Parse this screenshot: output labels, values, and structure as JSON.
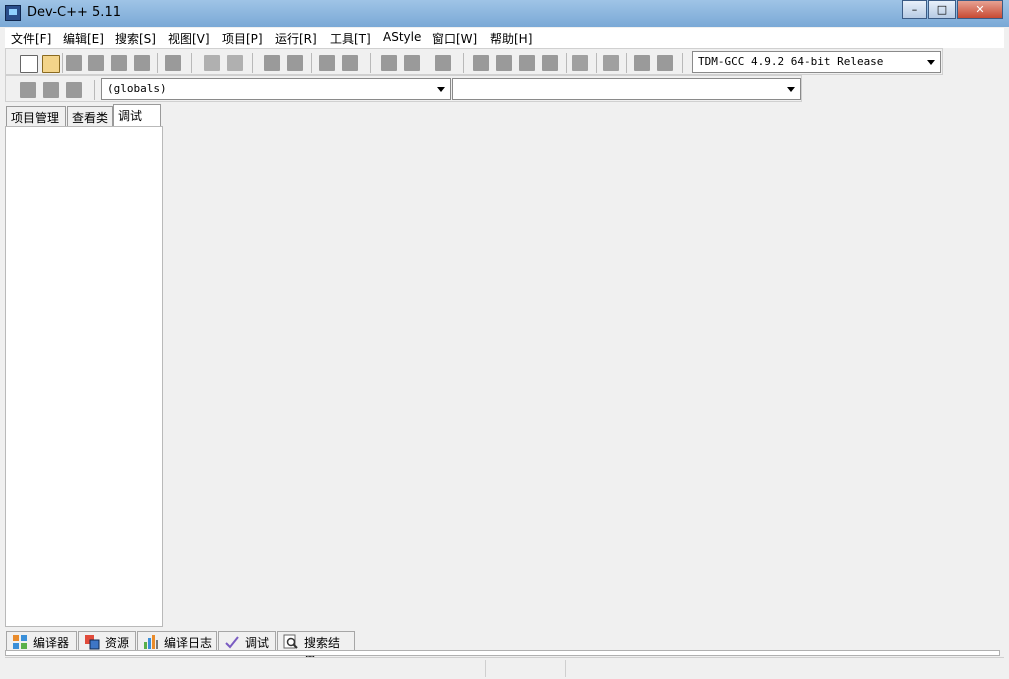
{
  "window": {
    "title": "Dev-C++ 5.11"
  },
  "menus": [
    {
      "label": "文件[F]"
    },
    {
      "label": "编辑[E]"
    },
    {
      "label": "搜索[S]"
    },
    {
      "label": "视图[V]"
    },
    {
      "label": "项目[P]"
    },
    {
      "label": "运行[R]"
    },
    {
      "label": "工具[T]"
    },
    {
      "label": "AStyle"
    },
    {
      "label": "窗口[W]"
    },
    {
      "label": "帮助[H]"
    }
  ],
  "toolbar": {
    "compiler_selected": "TDM-GCC 4.9.2 64-bit Release",
    "globals_selected": "(globals)",
    "members_selected": ""
  },
  "left_tabs": [
    {
      "label": "项目管理"
    },
    {
      "label": "查看类"
    },
    {
      "label": "调试"
    }
  ],
  "bottom_tabs": [
    {
      "label": "编译器"
    },
    {
      "label": "资源"
    },
    {
      "label": "编译日志"
    },
    {
      "label": "调试"
    },
    {
      "label": "搜索结果"
    }
  ],
  "icons": {
    "app": "devcpp-app-icon",
    "compiler_tab": "compiler-grid-icon",
    "resources_tab": "resources-icon",
    "log_tab": "bar-chart-icon",
    "debug_tab": "checkmark-icon",
    "search_tab": "magnifier-icon"
  },
  "colors": {
    "accent": "#7aa9d6",
    "panel_bg": "#f0f0f0"
  }
}
